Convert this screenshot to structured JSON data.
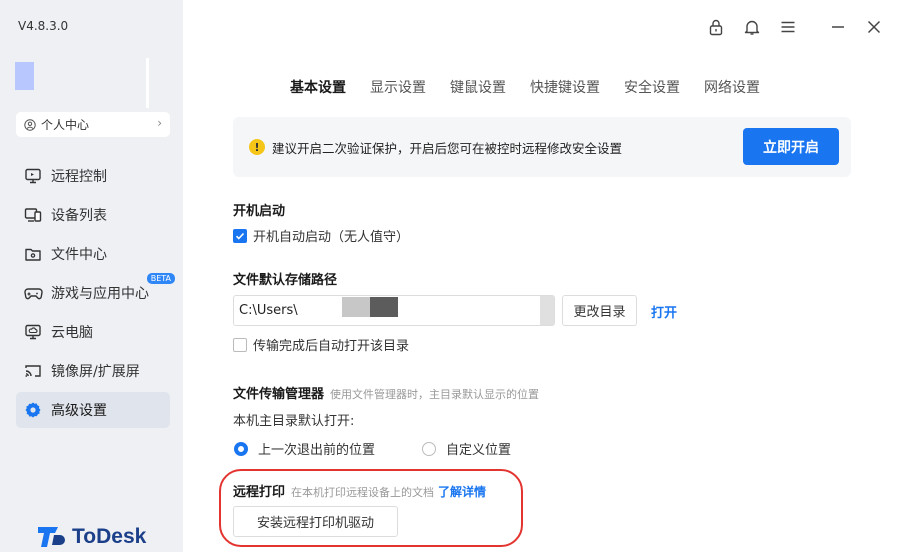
{
  "app": {
    "version": "V4.8.3.0",
    "logo_text": "ToDesk",
    "accent_color": "#1976f0"
  },
  "sidebar": {
    "profile_label": "个人中心",
    "items": [
      {
        "label": "远程控制",
        "icon": "monitor-icon"
      },
      {
        "label": "设备列表",
        "icon": "devices-icon"
      },
      {
        "label": "文件中心",
        "icon": "folder-icon"
      },
      {
        "label": "游戏与应用中心",
        "icon": "gamepad-icon",
        "badge": "BETA"
      },
      {
        "label": "云电脑",
        "icon": "cloud-pc-icon"
      },
      {
        "label": "镜像屏/扩展屏",
        "icon": "cast-icon"
      },
      {
        "label": "高级设置",
        "icon": "gear-icon",
        "active": true
      }
    ]
  },
  "tabs": [
    {
      "label": "基本设置",
      "active": true
    },
    {
      "label": "显示设置"
    },
    {
      "label": "键鼠设置"
    },
    {
      "label": "快捷键设置"
    },
    {
      "label": "安全设置"
    },
    {
      "label": "网络设置"
    }
  ],
  "banner": {
    "text": "建议开启二次验证保护，开启后您可在被控时远程修改安全设置",
    "button": "立即开启"
  },
  "startup": {
    "title": "开机启动",
    "checkbox_label": "开机自动启动（无人值守）",
    "checked": true
  },
  "storage": {
    "title": "文件默认存储路径",
    "path_value": "C:\\Users\\",
    "change_button": "更改目录",
    "open_link": "打开",
    "auto_open_label": "传输完成后自动打开该目录",
    "auto_open_checked": false
  },
  "file_manager": {
    "title": "文件传输管理器",
    "hint": "使用文件管理器时，主目录默认显示的位置",
    "sub_label": "本机主目录默认打开:",
    "options": [
      {
        "label": "上一次退出前的位置",
        "selected": true
      },
      {
        "label": "自定义位置",
        "selected": false
      }
    ]
  },
  "remote_print": {
    "title": "远程打印",
    "hint": "在本机打印远程设备上的文档",
    "learn_more": "了解详情",
    "install_button": "安装远程打印机驱动"
  }
}
